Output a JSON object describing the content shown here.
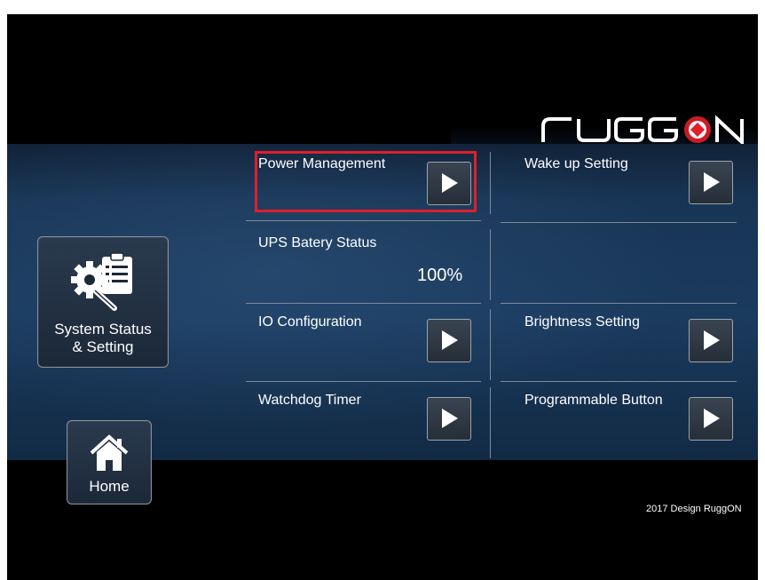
{
  "brand": {
    "logo_text": "RUGGON",
    "accent_color": "#e01f2a"
  },
  "sidebar": {
    "system_status": {
      "label": "System Status\n& Setting",
      "icon": "gears-clipboard-icon"
    },
    "home": {
      "label": "Home",
      "icon": "home-icon"
    }
  },
  "menu": {
    "items": [
      {
        "label": "Power Management",
        "has_button": true,
        "highlighted": true
      },
      {
        "label": "Wake up Setting",
        "has_button": true
      },
      {
        "label": "UPS Batery Status",
        "value": "100%"
      },
      {
        "label": ""
      },
      {
        "label": "IO Configuration",
        "has_button": true
      },
      {
        "label": "Brightness Setting",
        "has_button": true
      },
      {
        "label": "Watchdog Timer",
        "has_button": true
      },
      {
        "label": "Programmable Button",
        "has_button": true
      }
    ]
  },
  "footer": {
    "copyright": "2017 Design RuggON"
  }
}
